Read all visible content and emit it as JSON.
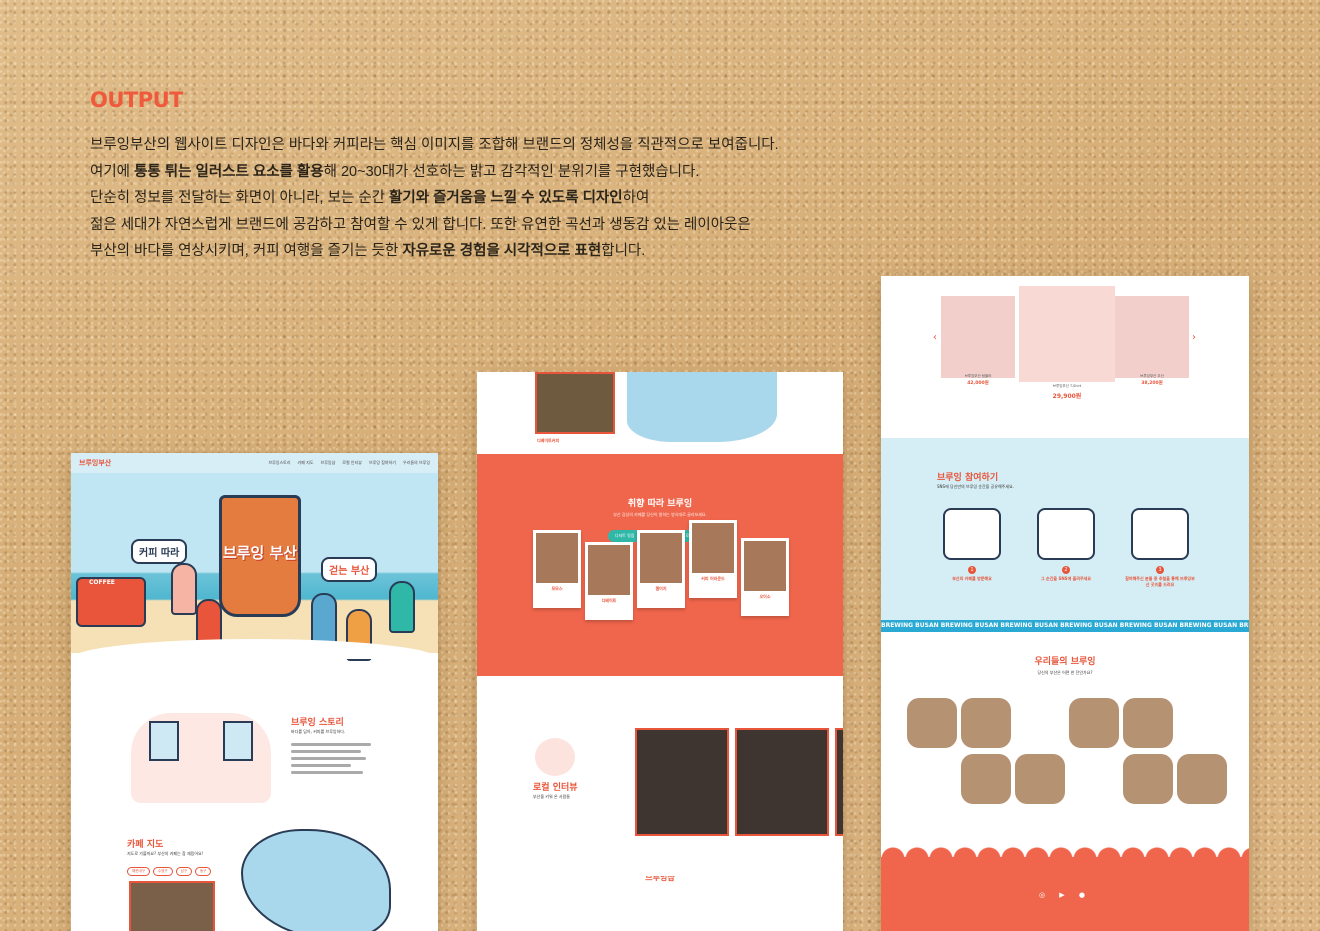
{
  "intro": {
    "title": "OUTPUT",
    "line1": "브루잉부산의 웹사이트 디자인은 바다와 커피라는 핵심 이미지를 조합해 브랜드의 정체성을 직관적으로 보여줍니다.",
    "line2_a": "여기에 ",
    "line2_b": "통통 튀는 일러스트 요소를 활용",
    "line2_c": "해 20~30대가 선호하는 밝고 감각적인 분위기를 구현했습니다.",
    "line3_a": "단순히 정보를 전달하는 화면이 아니라, 보는 순간 ",
    "line3_b": "활기와 즐거움을 느낄 수 있도록 디자인",
    "line3_c": "하여",
    "line4": "젊은 세대가 자연스럽게 브랜드에 공감하고 참여할 수 있게 합니다. 또한 유연한 곡선과 생동감 있는 레이아웃은",
    "line5_a": "부산의 바다를 연상시키며, 커피 여행을 즐기는 듯한 ",
    "line5_b": "자유로운 경험을 시각적으로 표현",
    "line5_c": "합니다."
  },
  "left_panel": {
    "logo": "브루잉부산",
    "menu": [
      "브루잉스토리",
      "카페 지도",
      "브루잉샵",
      "로컬 인터뷰",
      "브루잉샵",
      "브루잉 참여하기",
      "우리들의 브루잉"
    ],
    "hero_cup_title": "브루잉 부산",
    "bubble_left": "커피 따라",
    "bubble_right": "걷는 부산",
    "truck_label": "COFFEE",
    "story_title": "브루잉 스토리",
    "story_sub": "바다를 담아, 커피를 브루잉하다.",
    "map_title": "카페 지도",
    "map_sub": "지도로 가볼까요? 부산의 카페는 참 재밌어요!",
    "chips": [
      "해운대구",
      "수영구",
      "남구",
      "동구"
    ]
  },
  "mid_panel": {
    "top_card_label": "디베이트커피",
    "red_title": "취향 따라 브루잉",
    "red_sub": "부산 감성의 카페를 당신이 원하는 방식대로 골라보세요.",
    "tabs": [
      "디저트 맛집",
      "오션뷰",
      "로컬 브루잉"
    ],
    "polaroids": [
      "모모스",
      "디베이트",
      "젬이지",
      "커피 어라운드",
      "오이소"
    ],
    "interview_title": "로컬 인터뷰",
    "interview_sub": "부산을 키워 온 사람들",
    "icons": [
      "☕",
      "🥤",
      "🍩",
      "☕",
      "🧁",
      "🥤",
      "☕",
      "🍰",
      "☕",
      "🥤",
      "☕",
      "🍩",
      "☕",
      "🥤"
    ],
    "bottom_title": "브루잉샵"
  },
  "right_panel": {
    "goods": [
      {
        "name": "브루잉부산 텀블러",
        "price": "42,000원"
      },
      {
        "name": "브루잉부산 T-Shirt",
        "price": "29,900원"
      },
      {
        "name": "브루잉부산 우산",
        "price": "38,200원"
      }
    ],
    "join_title": "브루잉 참여하기",
    "join_sub": "SNS에 당신만의 브루잉 순간을 공유해주세요.",
    "steps": [
      {
        "num": "1",
        "text": "부산의 카페를 방문해요"
      },
      {
        "num": "2",
        "text": "그 순간을 SNS에 올려주세요"
      },
      {
        "num": "3",
        "text": "참여해주신 분들 중 추첨을 통해 브루잉부산 굿즈를 드려요"
      }
    ],
    "marquee": "BREWING BUSAN   BREWING BUSAN   BREWING BUSAN   BREWING BUSAN   BREWING BUSAN   BREWING BUSAN   BREWING BUSAN",
    "ours_title": "우리들의 브루잉",
    "ours_sub": "당신의 부산은 어떤 한 잔인가요?",
    "footer_icons": "◎ ▶ ●"
  },
  "colors": {
    "accent": "#f05a3c",
    "sky": "#d5eef5",
    "sand": "#d9b37f"
  }
}
